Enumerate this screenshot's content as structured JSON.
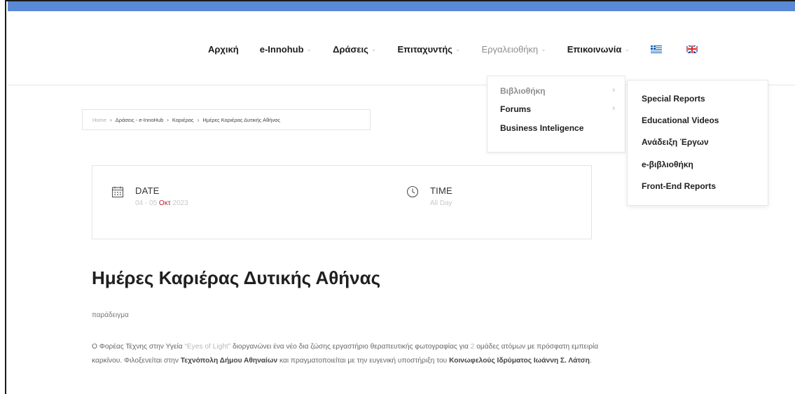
{
  "nav": {
    "items": [
      {
        "label": "Αρχική",
        "caret": false,
        "muted": false
      },
      {
        "label": "e-Innohub",
        "caret": true,
        "muted": false
      },
      {
        "label": "Δράσεις",
        "caret": true,
        "muted": false
      },
      {
        "label": "Επιταχυντής",
        "caret": true,
        "muted": false
      },
      {
        "label": "Εργαλειοθήκη",
        "caret": true,
        "muted": true
      },
      {
        "label": "Επικοινωνία",
        "caret": true,
        "muted": false
      }
    ],
    "caret_glyph": "⌄",
    "flags": [
      "greek-flag-icon",
      "uk-flag-icon"
    ]
  },
  "dropdown_primary": {
    "items": [
      {
        "label": "Βιβλιοθήκη",
        "chevron": "›",
        "muted": true
      },
      {
        "label": "Forums",
        "chevron": "›",
        "muted": false
      },
      {
        "label": "Business Inteligence",
        "chevron": "",
        "muted": false
      }
    ]
  },
  "dropdown_secondary": {
    "items": [
      "Special Reports",
      "Educational Videos",
      "Ανάδειξη Έργων",
      "e-βιβλιοθήκη",
      "Front-End Reports"
    ]
  },
  "breadcrumb": {
    "items": [
      "Home",
      "Δράσεις - e-InnoHub",
      "Καριέρας",
      "Ημέρες Καριέρας Δυτικής Αθήνας"
    ],
    "separator": "›"
  },
  "event": {
    "date_label": "DATE",
    "date_value_pre": "04 - 05",
    "date_value_month": "Οκτ",
    "date_value_year": "2023",
    "time_label": "TIME",
    "time_value": "All Day"
  },
  "article": {
    "title": "Ημέρες Καριέρας Δυτικής Αθήνας",
    "subtitle": "παράδειγμα",
    "p1_a": "Ο Φορέας Τέχνης στην Υγεία ",
    "p1_b": "“Eyes of Light”",
    "p1_c": " διοργανώνει ένα νέο δια ζώσης εργαστήριο θεραπευτικής φωτογραφίας για ",
    "p1_d": "2",
    "p1_e": " ομάδες ατόμων με πρόσφατη εμπειρία καρκίνου. Φιλοξενείται στην ",
    "p1_f": "Τεχνόπολη Δήμου Αθηναίων",
    "p1_g": " και πραγματοποιείται με την ευγενική υποστήριξη του ",
    "p1_h": "Κοινωφελούς Ιδρύματος Ιωάννη Σ. Λάτση",
    "p1_i": "."
  },
  "colors": {
    "accent_bar": "#5a8ad6",
    "month_accent": "#b3262d"
  }
}
